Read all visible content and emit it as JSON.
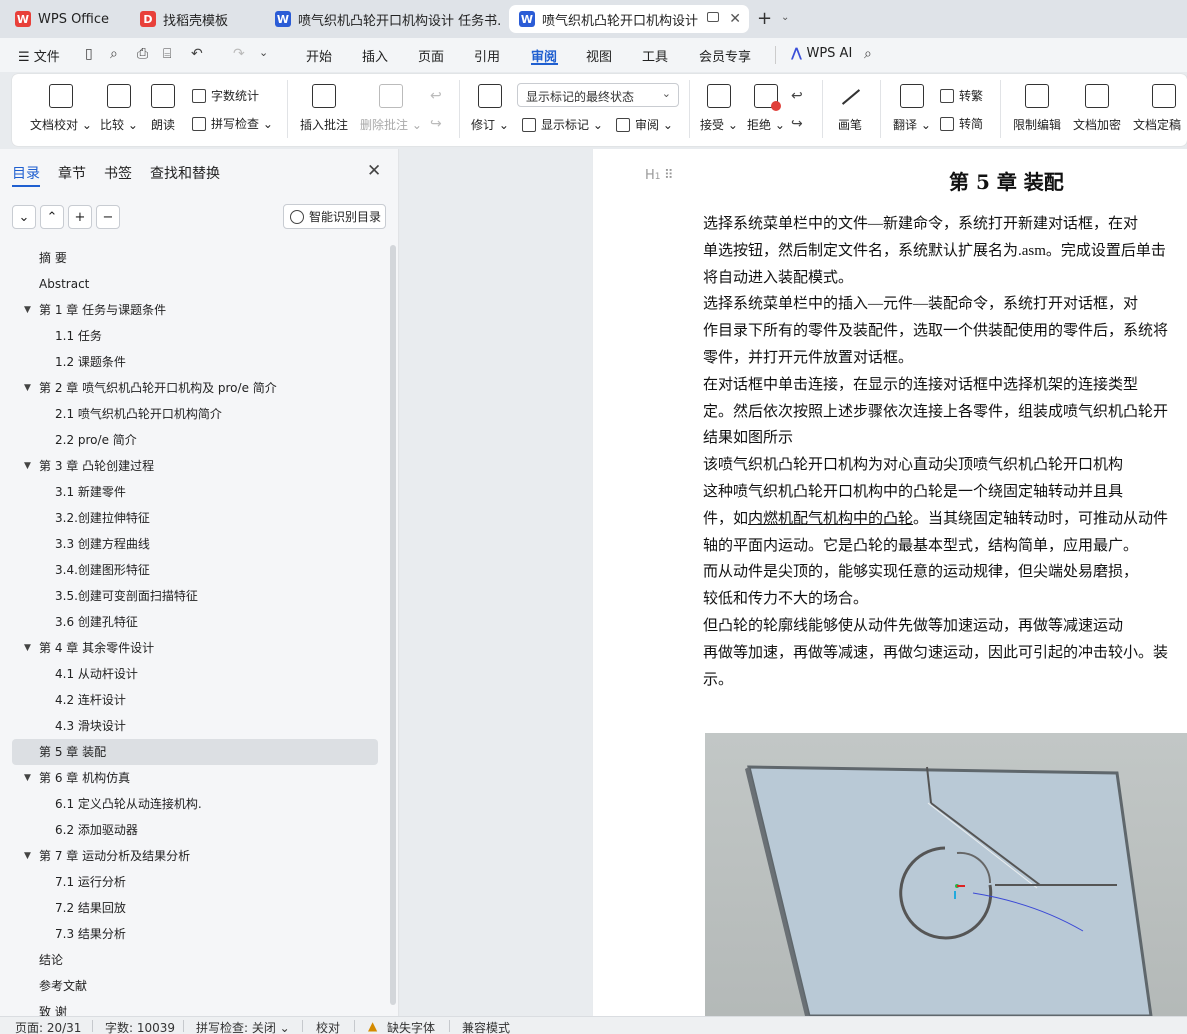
{
  "tabs": [
    {
      "label": "WPS Office",
      "icon": "wps-logo-icon",
      "color": "#e8403a"
    },
    {
      "label": "找稻壳模板",
      "icon": "docer-icon",
      "color": "#e8403a"
    },
    {
      "label": "喷气织机凸轮开口机构设计 任务书.dc",
      "icon": "word-doc-icon",
      "color": "#2b5cd6"
    },
    {
      "label": "喷气织机凸轮开口机构设计 毕",
      "icon": "word-doc-icon",
      "color": "#2b5cd6"
    }
  ],
  "menu": {
    "file": "文件",
    "items": [
      "开始",
      "插入",
      "页面",
      "引用",
      "审阅",
      "视图",
      "工具",
      "会员专享"
    ],
    "active": "审阅",
    "wps_ai": "WPS AI"
  },
  "ribbon": {
    "doc_compare": "文档校对",
    "compare": "比较",
    "read_aloud": "朗读",
    "word_count": "字数统计",
    "spell_check": "拼写检查",
    "insert_comment": "插入批注",
    "delete_comment": "删除批注",
    "track_changes": "修订",
    "markup_state": "显示标记的最终状态",
    "show_markup": "显示标记",
    "review": "审阅",
    "accept": "接受",
    "reject": "拒绝",
    "pen": "画笔",
    "translate": "翻译",
    "to_traditional": "转繁",
    "to_simplified": "转简",
    "restrict_edit": "限制编辑",
    "doc_encrypt": "文档加密",
    "doc_finalize": "文档定稿"
  },
  "sidebar": {
    "tabs": [
      "目录",
      "章节",
      "书签",
      "查找和替换"
    ],
    "active_tab": "目录",
    "smart_toc": "智能识别目录",
    "toc": [
      {
        "label": "摘 要",
        "level": 1,
        "expandable": false
      },
      {
        "label": "Abstract",
        "level": 1,
        "expandable": false
      },
      {
        "label": "第 1 章  任务与课题条件",
        "level": 1,
        "expandable": true
      },
      {
        "label": "1.1  任务",
        "level": 2,
        "expandable": false
      },
      {
        "label": "1.2  课题条件",
        "level": 2,
        "expandable": false
      },
      {
        "label": "第 2 章  喷气织机凸轮开口机构及 pro/e 简介",
        "level": 1,
        "expandable": true
      },
      {
        "label": "2.1  喷气织机凸轮开口机构简介",
        "level": 2,
        "expandable": false
      },
      {
        "label": "2.2 pro/e 简介",
        "level": 2,
        "expandable": false
      },
      {
        "label": "第 3 章  凸轮创建过程",
        "level": 1,
        "expandable": true
      },
      {
        "label": "3.1  新建零件",
        "level": 2,
        "expandable": false
      },
      {
        "label": "3.2.创建拉伸特征",
        "level": 2,
        "expandable": false
      },
      {
        "label": "3.3  创建方程曲线",
        "level": 2,
        "expandable": false
      },
      {
        "label": "3.4.创建图形特征",
        "level": 2,
        "expandable": false
      },
      {
        "label": "3.5.创建可变剖面扫描特征",
        "level": 2,
        "expandable": false
      },
      {
        "label": "3.6 创建孔特征",
        "level": 2,
        "expandable": false
      },
      {
        "label": "第 4 章    其余零件设计",
        "level": 1,
        "expandable": true
      },
      {
        "label": "4.1 从动杆设计",
        "level": 2,
        "expandable": false
      },
      {
        "label": "4.2 连杆设计",
        "level": 2,
        "expandable": false
      },
      {
        "label": "4.3 滑块设计",
        "level": 2,
        "expandable": false
      },
      {
        "label": "第 5 章  装配",
        "level": 1,
        "expandable": false,
        "active": true
      },
      {
        "label": "第 6 章  机构仿真",
        "level": 1,
        "expandable": true
      },
      {
        "label": "6.1  定义凸轮从动连接机构.",
        "level": 2,
        "expandable": false
      },
      {
        "label": "6.2  添加驱动器",
        "level": 2,
        "expandable": false
      },
      {
        "label": "第 7 章    运动分析及结果分析",
        "level": 1,
        "expandable": true
      },
      {
        "label": "7.1  运行分析",
        "level": 2,
        "expandable": false
      },
      {
        "label": "7.2    结果回放",
        "level": 2,
        "expandable": false
      },
      {
        "label": "7.3    结果分析",
        "level": 2,
        "expandable": false
      },
      {
        "label": "结论",
        "level": 1,
        "expandable": false
      },
      {
        "label": "参考文献",
        "level": 1,
        "expandable": false
      },
      {
        "label": "致 谢",
        "level": 1,
        "expandable": false
      }
    ]
  },
  "document": {
    "heading_marker": "H",
    "chapter_title": "第 5 章  装配",
    "lines": [
      "        选择系统菜单栏中的文件—新建命令，系统打开新建对话框，在对",
      "单选按钮，然后制定文件名，系统默认扩展名为.asm。完成设置后单击",
      "将自动进入装配模式。",
      "        选择系统菜单栏中的插入—元件—装配命令，系统打开对话框，对",
      "作目录下所有的零件及装配件，选取一个供装配使用的零件后，系统将",
      "零件，并打开元件放置对话框。",
      "        在对话框中单击连接，在显示的连接对话框中选择机架的连接类型",
      "定。然后依次按照上述步骤依次连接上各零件，组装成喷气织机凸轮开",
      "结果如图所示",
      "        该喷气织机凸轮开口机构为对心直动尖顶喷气织机凸轮开口机构",
      "        这种喷气织机凸轮开口机构中的凸轮是一个绕固定轴转动并且具",
      "件，如内燃机配气机构中的凸轮。当其绕固定轴转动时，可推动从动件",
      "轴的平面内运动。它是凸轮的最基本型式，结构简单，应用最广。",
      "        而从动件是尖顶的，能够实现任意的运动规律，但尖端处易磨损，",
      "较低和传力不大的场合。",
      "        但凸轮的轮廓线能够使从动件先做等加速运动，再做等减速运动",
      "再做等加速，再做等减速，再做匀速运动，因此可引起的冲击较小。装",
      "示。"
    ],
    "underline_text": "内燃机配气机构中的凸轮"
  },
  "status": {
    "page": "页面: 20/31",
    "word_count": "字数: 10039",
    "spell_check": "拼写检查: 关闭",
    "proof": "校对",
    "missing_font": "缺失字体",
    "compat": "兼容模式"
  }
}
